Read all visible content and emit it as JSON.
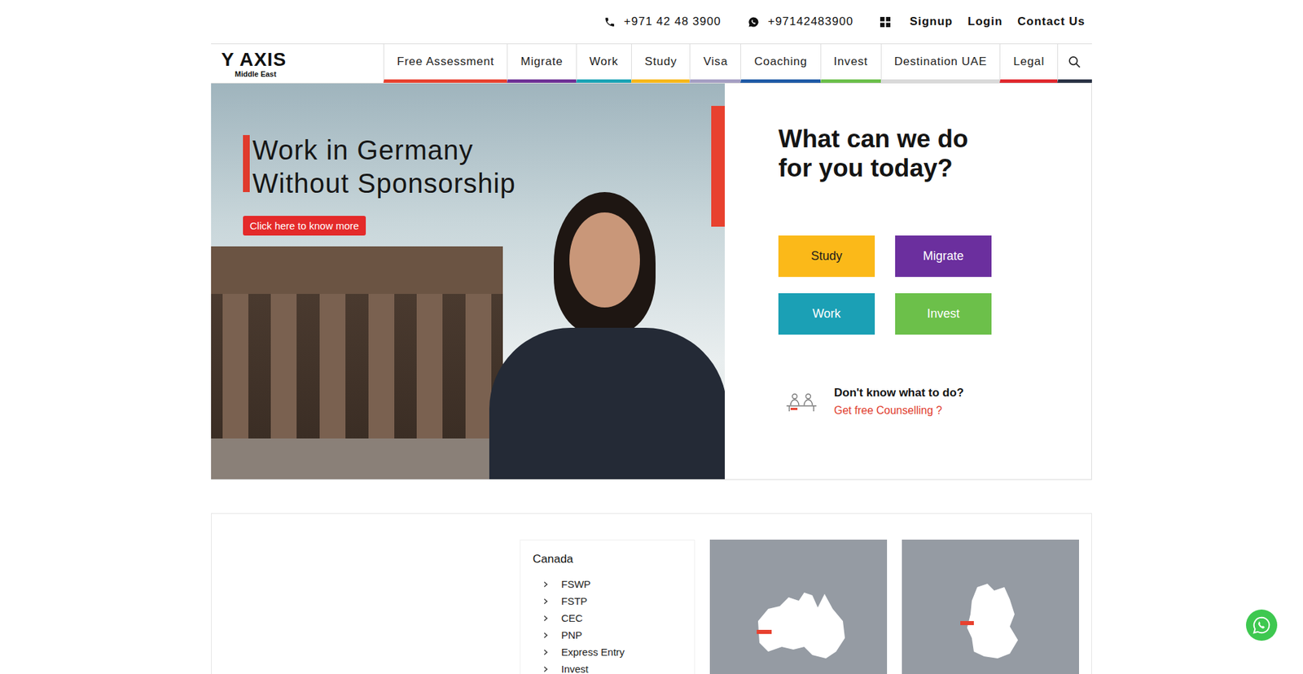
{
  "topbar": {
    "phone": "+971 42 48 3900",
    "whatsapp": "+97142483900",
    "links": [
      "Signup",
      "Login",
      "Contact Us"
    ]
  },
  "logo": {
    "name": "Y AXIS",
    "tagline": "Middle East"
  },
  "nav": [
    {
      "label": "Free Assessment",
      "color": "#e8412f"
    },
    {
      "label": "Migrate",
      "color": "#6e3196"
    },
    {
      "label": "Work",
      "color": "#1aa3b5"
    },
    {
      "label": "Study",
      "color": "#f7b81b"
    },
    {
      "label": "Visa",
      "color": "#a59fc3"
    },
    {
      "label": "Coaching",
      "color": "#1f5aa6"
    },
    {
      "label": "Invest",
      "color": "#6bbf4a"
    },
    {
      "label": "Destination UAE",
      "color": "#d9d9d9"
    },
    {
      "label": "Legal",
      "color": "#e0282e"
    }
  ],
  "hero": {
    "title": [
      "Work in Germany",
      "Without Sponsorship"
    ],
    "button": "Click here to know more"
  },
  "panel": {
    "heading": "What can we do for you today?",
    "actions": [
      {
        "label": "Study",
        "color": "#fbb919"
      },
      {
        "label": "Migrate",
        "color": "#6b2f9e"
      },
      {
        "label": "Work",
        "color": "#1ba0b5"
      },
      {
        "label": "Invest",
        "color": "#6cc04a"
      }
    ],
    "help": {
      "question": "Don't know what to do?",
      "link": "Get free Counselling ?"
    }
  },
  "programs": {
    "country": "Canada",
    "items": [
      "FSWP",
      "FSTP",
      "CEC",
      "PNP",
      "Express Entry",
      "Invest"
    ]
  }
}
